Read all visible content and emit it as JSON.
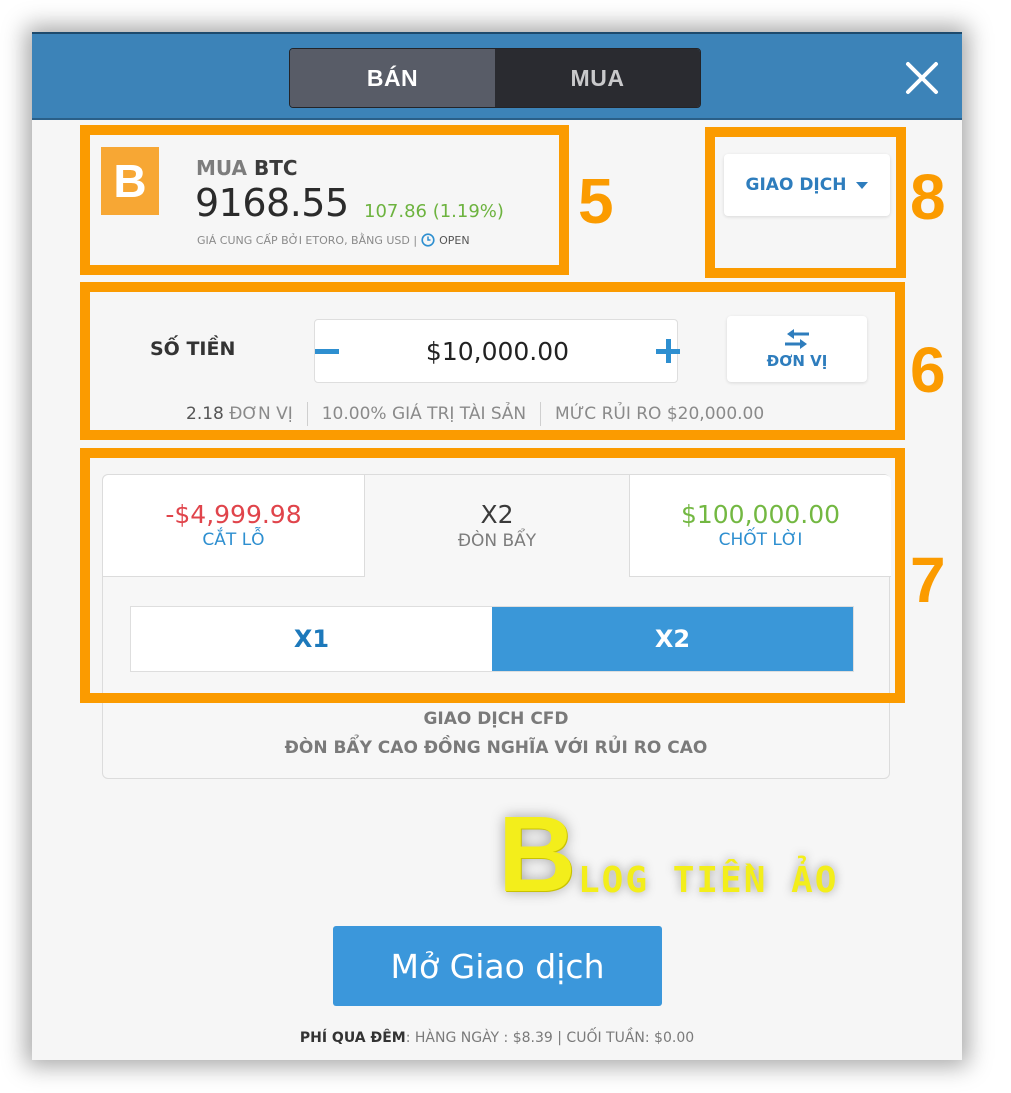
{
  "header": {
    "side_toggle": [
      {
        "label": "BÁN",
        "selected": true
      },
      {
        "label": "MUA",
        "selected": false
      }
    ],
    "close_icon": "close-icon"
  },
  "asset": {
    "icon_glyph": "B",
    "action": "MUA",
    "symbol": "BTC",
    "price": "9168.55",
    "change": "107.86 (1.19%)",
    "provider_text": "GIÁ CUNG CẤP BỞI ETORO, BẰNG USD |",
    "market_status": "OPEN",
    "colors": {
      "icon_bg": "#f7a734",
      "change": "#6db33f"
    }
  },
  "trade_type": {
    "label": "GIAO DỊCH"
  },
  "amount": {
    "label": "SỐ TIỀN",
    "value": "$10,000.00",
    "units_button_label": "ĐƠN VỊ",
    "info": {
      "units_num": "2.18",
      "units_text": "ĐƠN VỊ",
      "asset_value": "10.00% GIÁ TRỊ TÀI SẢN",
      "risk": "MỨC RỦI RO $20,000.00"
    }
  },
  "risk": {
    "stop_loss": {
      "value": "-$4,999.98",
      "label": "CẮT LỖ"
    },
    "leverage": {
      "value": "X2",
      "label": "ĐÒN BẨY"
    },
    "take_profit": {
      "value": "$100,000.00",
      "label": "CHỐT LỜI"
    },
    "leverage_options": [
      {
        "label": "X1",
        "selected": false
      },
      {
        "label": "X2",
        "selected": true
      }
    ],
    "note_line1": "GIAO DỊCH CFD",
    "note_line2": "ĐÒN BẨY CAO ĐỒNG NGHĨA VỚI RỦI RO CAO"
  },
  "annotations": [
    "5",
    "6",
    "7",
    "8"
  ],
  "watermark": {
    "big_letter": "B",
    "rest": "LOG TIỀN ẢO"
  },
  "open_trade_label": "Mở Giao dịch",
  "fees": {
    "key": "PHÍ QUA ĐÊM",
    "text": ": HÀNG NGÀY : $8.39 | CUỐI TUẦN: $0.00"
  },
  "colors": {
    "header_bg": "#3c83b8",
    "accent_blue": "#3b97db",
    "annotation_orange": "#fb9b00",
    "stop_loss_red": "#e0444b",
    "take_profit_green": "#73b842"
  }
}
